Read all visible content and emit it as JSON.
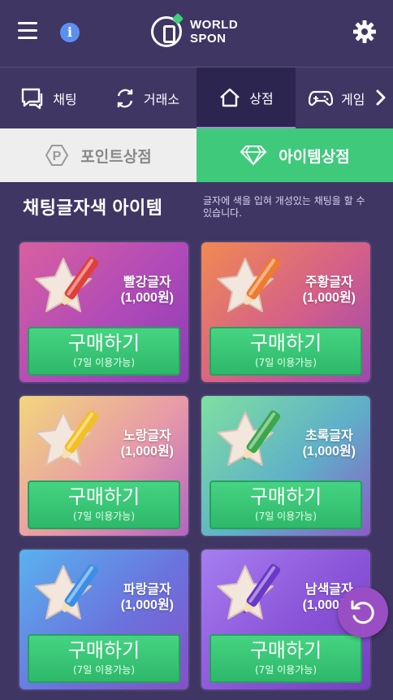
{
  "header": {
    "logo_line1": "WORLD",
    "logo_line2": "SPON",
    "menu_icon": "hamburger-icon",
    "info_icon": "info-icon",
    "settings_icon": "gear-icon"
  },
  "tabs": [
    {
      "label": "채팅",
      "icon": "chat-icon",
      "active": false
    },
    {
      "label": "거래소",
      "icon": "exchange-icon",
      "active": false
    },
    {
      "label": "상점",
      "icon": "home-icon",
      "active": true
    },
    {
      "label": "게임",
      "icon": "gamepad-icon",
      "active": false
    }
  ],
  "shop_tabs": {
    "point": "포인트상점",
    "item": "아이템상점"
  },
  "section": {
    "title": "채팅글자색 아이템",
    "description": "글자에 색을 입혀 개성있는 채팅을 할 수 있습니다."
  },
  "items": [
    {
      "name": "빨강글자",
      "price": "(1,000원)",
      "buy": "구매하기",
      "period": "(7일 이용가능)",
      "color": "#e0403a"
    },
    {
      "name": "주황글자",
      "price": "(1,000원)",
      "buy": "구매하기",
      "period": "(7일 이용가능)",
      "color": "#f07a30"
    },
    {
      "name": "노랑글자",
      "price": "(1,000원)",
      "buy": "구매하기",
      "period": "(7일 이용가능)",
      "color": "#f2c020"
    },
    {
      "name": "초록글자",
      "price": "(1,000원)",
      "buy": "구매하기",
      "period": "(7일 이용가능)",
      "color": "#3aa84a"
    },
    {
      "name": "파랑글자",
      "price": "(1,000원)",
      "buy": "구매하기",
      "period": "(7일 이용가능)",
      "color": "#3a8ee8"
    },
    {
      "name": "남색글자",
      "price": "(1,000원)",
      "buy": "구매하기",
      "period": "(7일 이용가능)",
      "color": "#6a38c8"
    }
  ],
  "colors": {
    "background": "#3f3664",
    "accent_green": "#3fc97b",
    "float_button": "#9a4ec4"
  }
}
